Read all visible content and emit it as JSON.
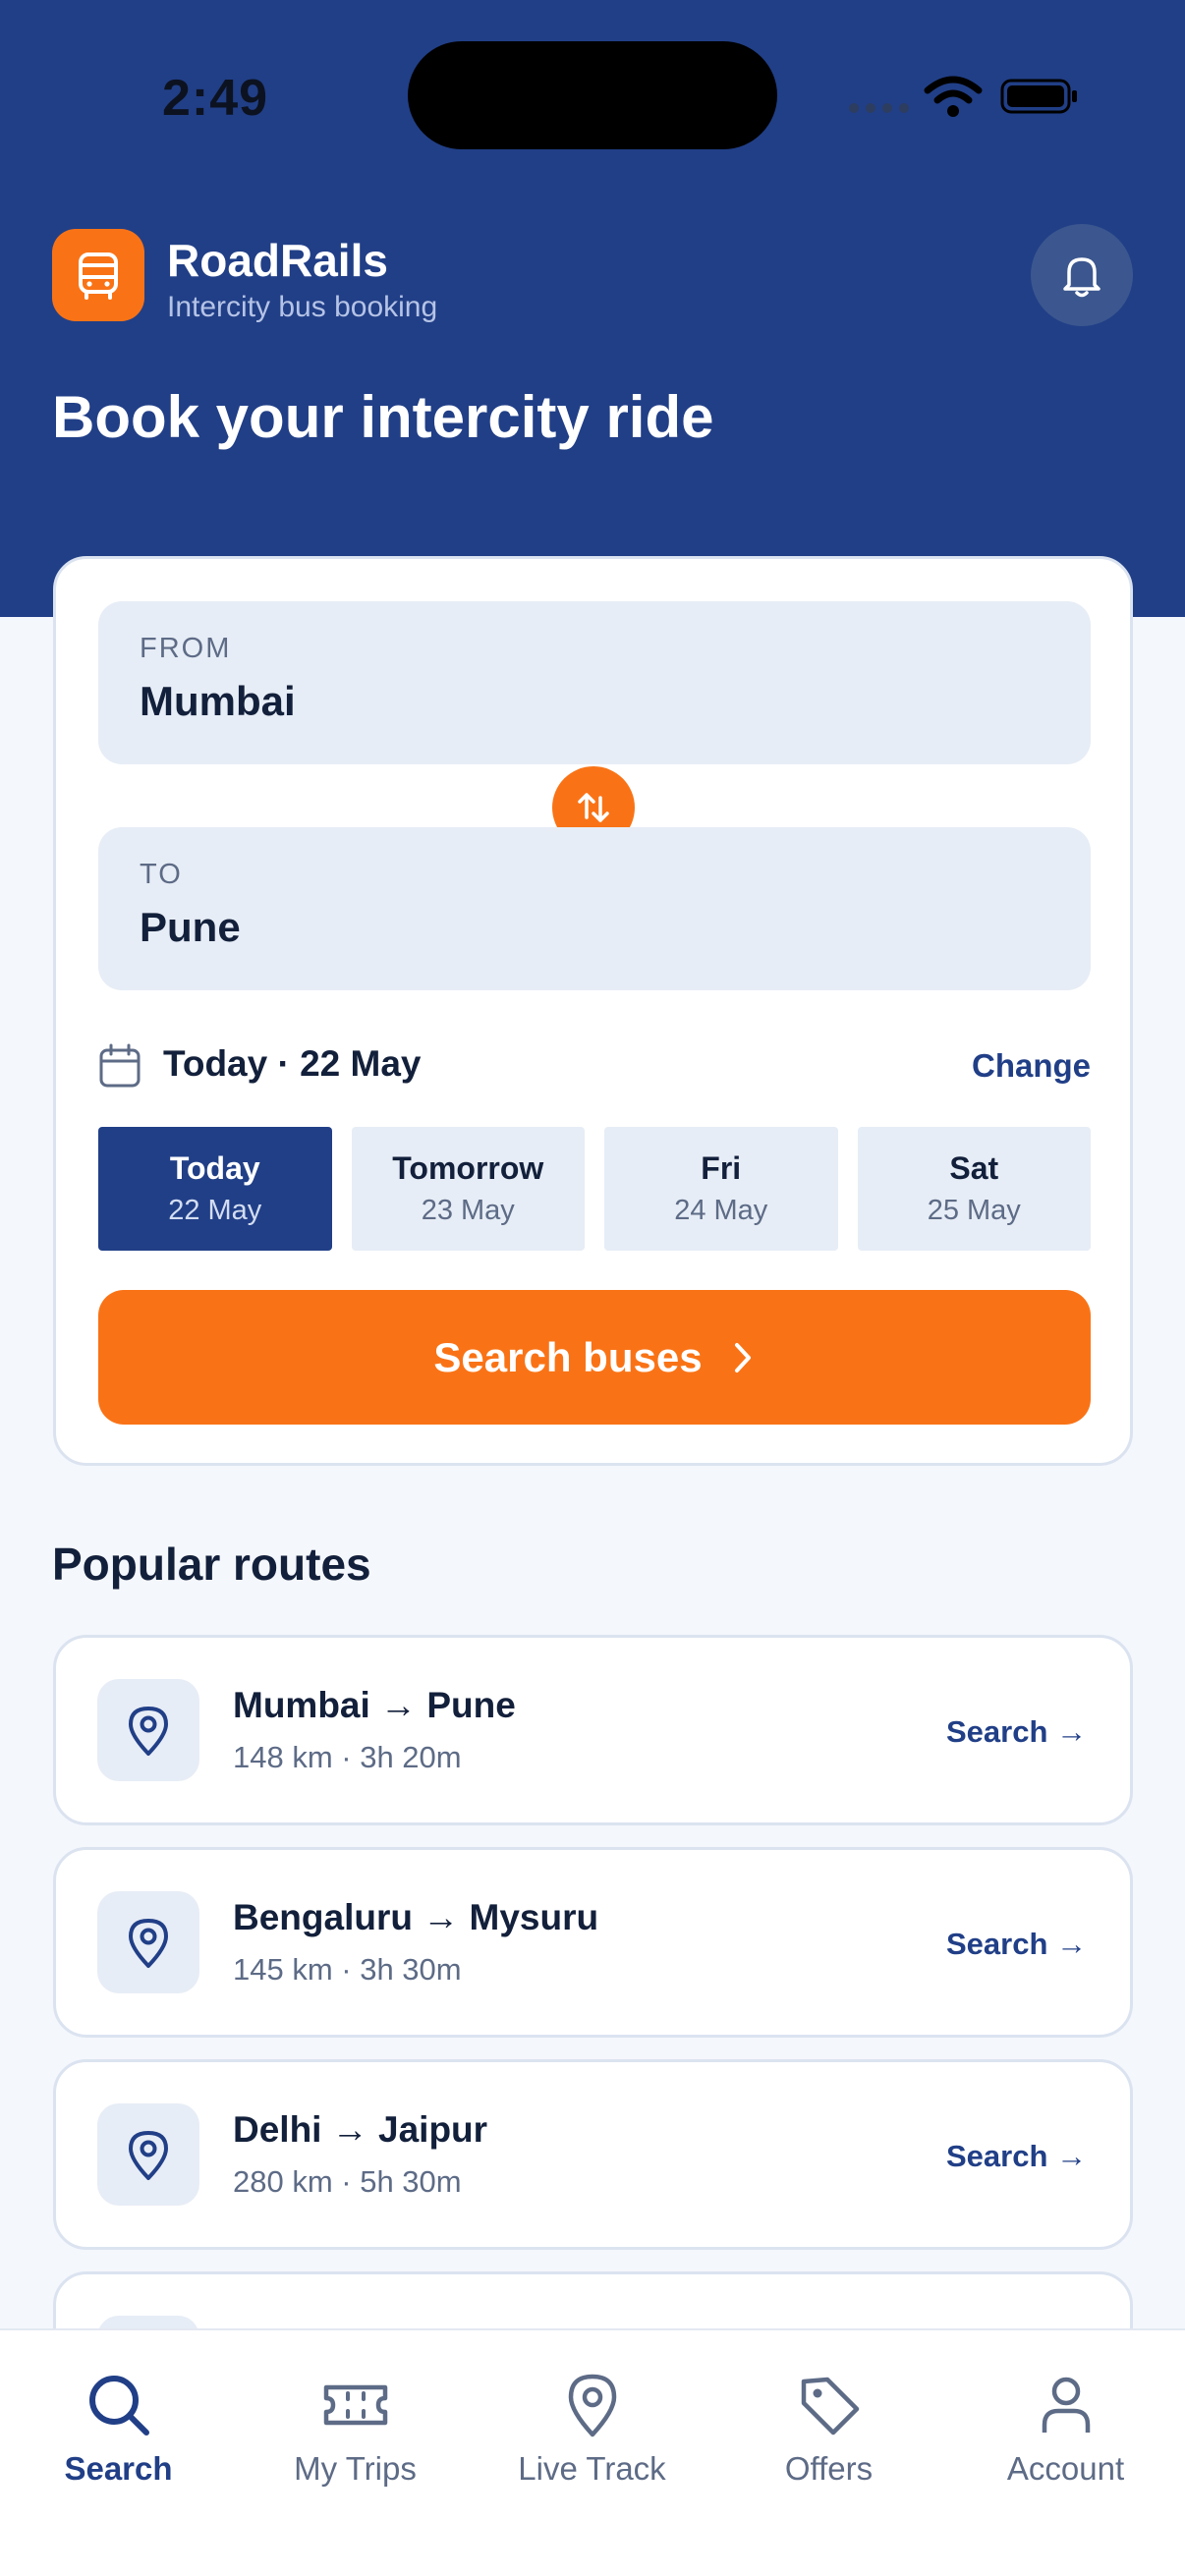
{
  "status_bar": {
    "time": "2:49"
  },
  "header": {
    "app_name": "RoadRails",
    "tagline": "Intercity bus booking",
    "title": "Book your intercity ride",
    "icons": {
      "logo": "bus-icon",
      "notifications": "bell-icon"
    }
  },
  "booking": {
    "from": {
      "label": "FROM",
      "value": "Mumbai"
    },
    "to": {
      "label": "TO",
      "value": "Pune"
    },
    "selected_date": "Today · 22 May",
    "change_label": "Change",
    "date_chips": [
      {
        "day": "Today",
        "date": "22 May",
        "active": true
      },
      {
        "day": "Tomorrow",
        "date": "23 May",
        "active": false
      },
      {
        "day": "Fri",
        "date": "24 May",
        "active": false
      },
      {
        "day": "Sat",
        "date": "25 May",
        "active": false
      }
    ],
    "search_label": "Search buses"
  },
  "popular": {
    "title": "Popular routes",
    "routes": [
      {
        "name": "Mumbai → Pune",
        "meta": "148 km · 3h 20m",
        "action": "Search →"
      },
      {
        "name": "Bengaluru → Mysuru",
        "meta": "145 km · 3h 30m",
        "action": "Search →"
      },
      {
        "name": "Delhi → Jaipur",
        "meta": "280 km · 5h 30m",
        "action": "Search →"
      }
    ]
  },
  "nav": {
    "items": [
      {
        "label": "Search",
        "icon": "search-icon",
        "active": true
      },
      {
        "label": "My Trips",
        "icon": "ticket-icon",
        "active": false
      },
      {
        "label": "Live Track",
        "icon": "location-pin-icon",
        "active": false
      },
      {
        "label": "Offers",
        "icon": "tag-icon",
        "active": false
      },
      {
        "label": "Account",
        "icon": "user-icon",
        "active": false
      }
    ]
  },
  "colors": {
    "primary": "#213f87",
    "accent": "#f97316",
    "background": "#f4f7fc",
    "field": "#e7edf6"
  }
}
